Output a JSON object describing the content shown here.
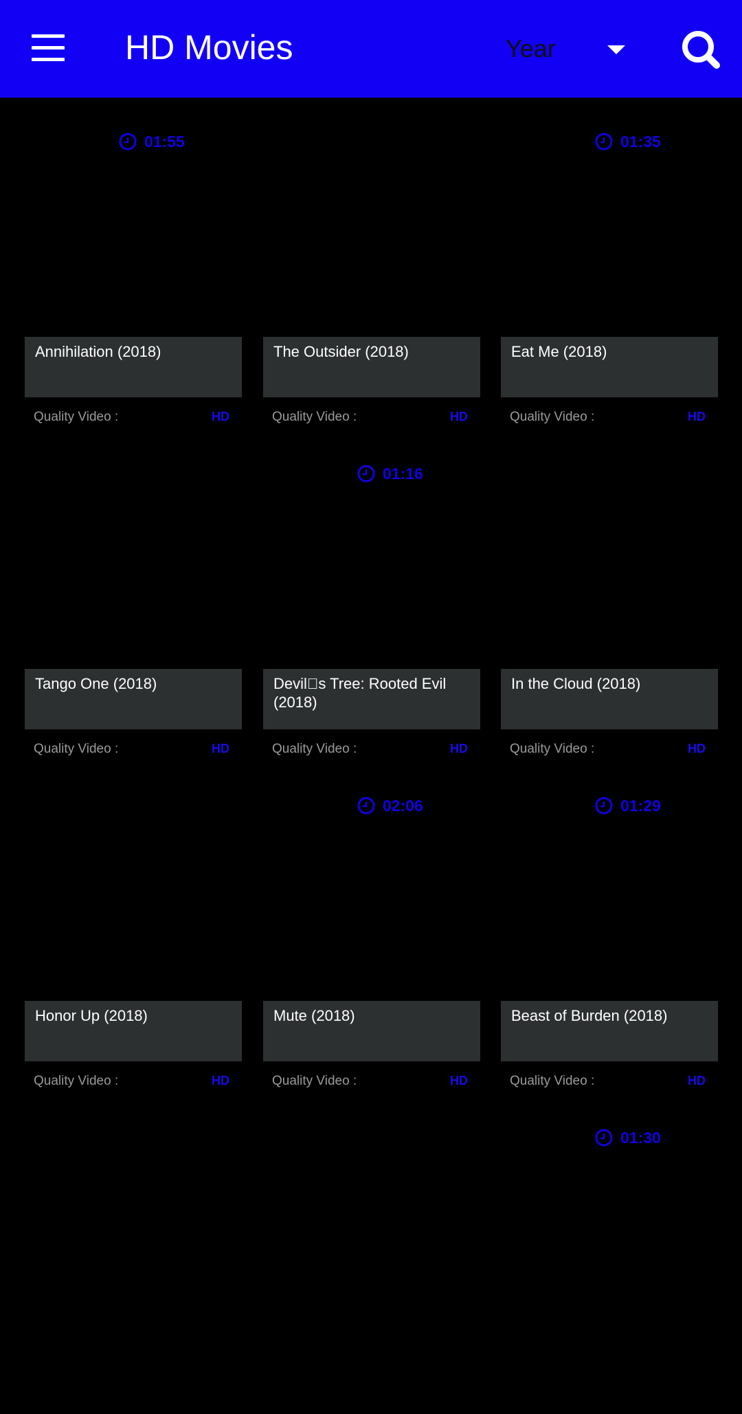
{
  "app_bar": {
    "title": "HD Movies",
    "menu_icon": "hamburger-menu-icon",
    "filter": {
      "selected": "Year",
      "icon": "dropdown-arrow-icon"
    },
    "search_icon": "search-icon",
    "background_color": "#1200f5"
  },
  "movies": [
    {
      "title": "Annihilation (2018)",
      "duration": "01:55",
      "quality_label": "Quality Video :",
      "quality": "HD"
    },
    {
      "title": "The Outsider (2018)",
      "duration": "",
      "quality_label": "Quality Video :",
      "quality": "HD"
    },
    {
      "title": "Eat Me (2018)",
      "duration": "01:35",
      "quality_label": "Quality Video :",
      "quality": "HD"
    },
    {
      "title": "Tango One (2018)",
      "duration": "",
      "quality_label": "Quality Video :",
      "quality": "HD"
    },
    {
      "title": "Devil\u0000s Tree: Rooted Evil (2018)",
      "duration": "01:16",
      "quality_label": "Quality Video :",
      "quality": "HD"
    },
    {
      "title": "In the Cloud (2018)",
      "duration": "",
      "quality_label": "Quality Video :",
      "quality": "HD"
    },
    {
      "title": "Honor Up (2018)",
      "duration": "",
      "quality_label": "Quality Video :",
      "quality": "HD"
    },
    {
      "title": "Mute (2018)",
      "duration": "02:06",
      "quality_label": "Quality Video :",
      "quality": "HD"
    },
    {
      "title": "Beast of Burden (2018)",
      "duration": "01:29",
      "quality_label": "Quality Video :",
      "quality": "HD"
    },
    {
      "title": "",
      "duration": "",
      "quality_label": "",
      "quality": ""
    },
    {
      "title": "",
      "duration": "",
      "quality_label": "",
      "quality": ""
    },
    {
      "title": "",
      "duration": "01:30",
      "quality_label": "",
      "quality": ""
    }
  ],
  "colors": {
    "accent": "#1300e0",
    "card_title_bg": "#2d3031",
    "background": "#000000",
    "quality_label": "#9a9a9a"
  }
}
